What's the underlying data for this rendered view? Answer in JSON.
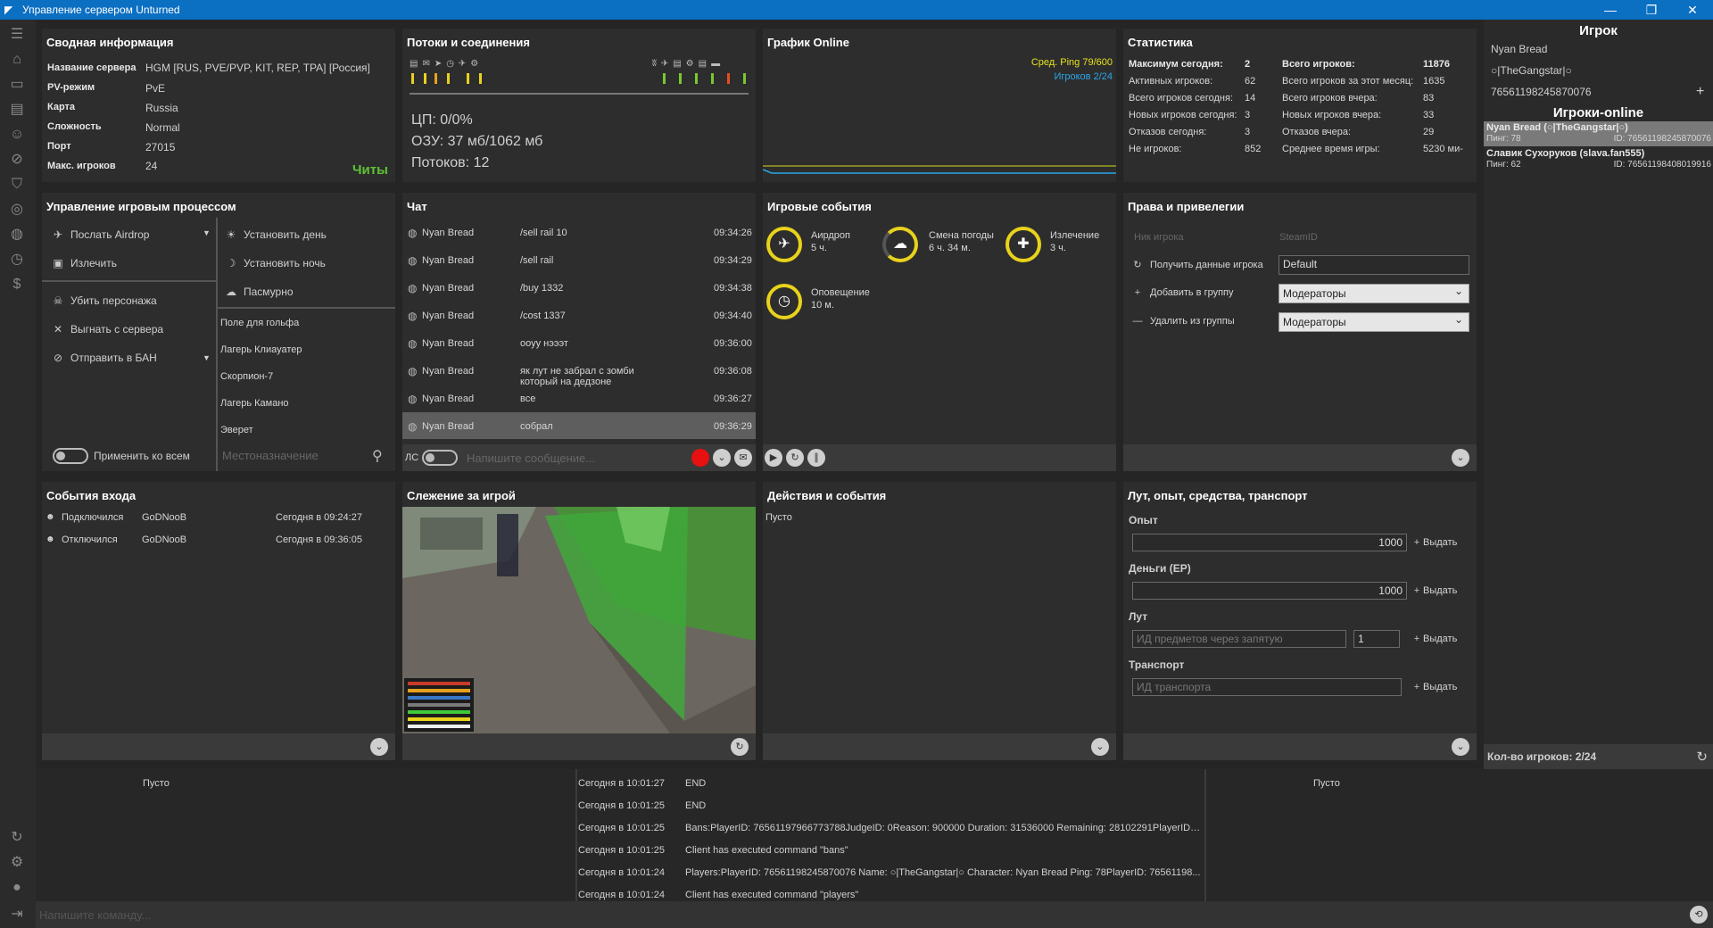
{
  "window": {
    "title": "Управление сервером Unturned",
    "min": "—",
    "max": "❐",
    "close": "✕"
  },
  "summary": {
    "title": "Сводная информация",
    "rows": [
      {
        "k": "Название сервера",
        "v": "HGM [RUS, PVE/PVP, KIT, REP, TPA] [Россия]"
      },
      {
        "k": "PV-режим",
        "v": "PvE"
      },
      {
        "k": "Карта",
        "v": "Russia"
      },
      {
        "k": "Сложность",
        "v": "Normal"
      },
      {
        "k": "Порт",
        "v": "27015"
      },
      {
        "k": "Макс. игроков",
        "v": "24"
      }
    ],
    "cheats": "Читы"
  },
  "threads": {
    "title": "Потоки и соединения",
    "cpu": "ЦП: 0/0%",
    "ram": "ОЗУ: 37 мб/1062 мб",
    "threads": "Потоков: 12"
  },
  "graph": {
    "title": "График Online",
    "ping": "Сред. Ping 79/600",
    "players": "Игроков 2/24"
  },
  "stats": {
    "title": "Статистика",
    "left": [
      {
        "k": "Максимум сегодня:",
        "v": "2"
      },
      {
        "k": "Активных игроков:",
        "v": "62"
      },
      {
        "k": "Всего игроков сегодня:",
        "v": "14"
      },
      {
        "k": "Новых игроков сегодня:",
        "v": "3"
      },
      {
        "k": "Отказов сегодня:",
        "v": "3"
      },
      {
        "k": "Не игроков:",
        "v": "852"
      }
    ],
    "right": [
      {
        "k": "Всего игроков:",
        "v": "11876"
      },
      {
        "k": "Всего игроков за этот месяц:",
        "v": "1635"
      },
      {
        "k": "Всего игроков вчера:",
        "v": "83"
      },
      {
        "k": "Новых игроков вчера:",
        "v": "33"
      },
      {
        "k": "Отказов вчера:",
        "v": "29"
      },
      {
        "k": "Среднее время игры:",
        "v": "5230 ми-"
      }
    ]
  },
  "player": {
    "title": "Игрок",
    "name": "Nyan Bread",
    "tag": "○|TheGangstar|○",
    "id": "76561198245870076",
    "online_title": "Игроки-online",
    "online": [
      {
        "name": "Nyan Bread (○|TheGangstar|○)",
        "ping": "Пинг: 78",
        "id": "ID: 76561198245870076"
      },
      {
        "name": "Славик Сухоруков (slava.fan555)",
        "ping": "Пинг: 62",
        "id": "ID: 76561198408019916"
      }
    ],
    "count": "Кол-во игроков: 2/24"
  },
  "game": {
    "title": "Управление игровым процессом",
    "left": [
      "Послать Airdrop",
      "Излечить",
      "Убить персонажа",
      "Выгнать с сервера",
      "Отправить в БАН"
    ],
    "right": [
      "Установить день",
      "Установить ночь",
      "Пасмурно"
    ],
    "locations": [
      "Поле для гольфа",
      "Лагерь Клиауатер",
      "Скорпион-7",
      "Лагерь Камано",
      "Эверет"
    ],
    "apply_all": "Применить ко всем",
    "dest_placeholder": "Местоназначение"
  },
  "chat": {
    "title": "Чат",
    "messages": [
      {
        "u": "Nyan Bread",
        "m": "/sell rail 10",
        "t": "09:34:26"
      },
      {
        "u": "Nyan Bread",
        "m": "/sell rail",
        "t": "09:34:29"
      },
      {
        "u": "Nyan Bread",
        "m": "/buy 1332",
        "t": "09:34:38"
      },
      {
        "u": "Nyan Bread",
        "m": "/cost 1337",
        "t": "09:34:40"
      },
      {
        "u": "Nyan Bread",
        "m": "ооуу нэээт",
        "t": "09:36:00"
      },
      {
        "u": "Nyan Bread",
        "m": "як лут не забрал с зомби который на дедзоне",
        "t": "09:36:08"
      },
      {
        "u": "Nyan Bread",
        "m": "все",
        "t": "09:36:27"
      },
      {
        "u": "Nyan Bread",
        "m": "собрал",
        "t": "09:36:29"
      }
    ],
    "ls": "ЛС",
    "placeholder": "Напишите сообщение..."
  },
  "events": {
    "title": "Игровые события",
    "items": [
      {
        "n": "Аирдроп",
        "t": "5 ч."
      },
      {
        "n": "Смена погоды",
        "t": "6 ч. 34 м."
      },
      {
        "n": "Излечение",
        "t": "3 ч."
      },
      {
        "n": "Оповещение",
        "t": "10 м."
      }
    ]
  },
  "rights": {
    "title": "Права и привелегии",
    "nick_ph": "Ник игрока",
    "steam_ph": "SteamID",
    "get": "Получить данные игрока",
    "group_value": "Default",
    "add": "Добавить в группу",
    "remove": "Удалить из группы",
    "group1": "Модераторы",
    "group2": "Модераторы"
  },
  "login": {
    "title": "События входа",
    "rows": [
      {
        "a": "Подключился",
        "u": "GoDNooB",
        "t": "Сегодня в 09:24:27"
      },
      {
        "a": "Отключился",
        "u": "GoDNooB",
        "t": "Сегодня в 09:36:05"
      }
    ]
  },
  "spectate": {
    "title": "Слежение за игрой"
  },
  "actions": {
    "title": "Действия и события",
    "empty": "Пусто"
  },
  "loot": {
    "title": "Лут, опыт, средства, транспорт",
    "exp": "Опыт",
    "exp_v": "1000",
    "money": "Деньги (ЕР)",
    "money_v": "1000",
    "loot": "Лут",
    "loot_ph": "ИД предметов через запятую",
    "qty": "1",
    "transport": "Транспорт",
    "transport_ph": "ИД транспорта",
    "give": "Выдать"
  },
  "console": {
    "left": "Пусто",
    "right": "Пусто",
    "placeholder": "Напишите команду...",
    "lines": [
      {
        "t": "Сегодня в 10:01:27",
        "m": "END"
      },
      {
        "t": "Сегодня в 10:01:25",
        "m": "END"
      },
      {
        "t": "Сегодня в 10:01:25",
        "m": "Bans:PlayerID: 76561197966773788JudgeID: 0Reason: 900000 Duration: 31536000 Remaining: 28102291PlayerID: ..."
      },
      {
        "t": "Сегодня в 10:01:25",
        "m": "Client has executed command \"bans\""
      },
      {
        "t": "Сегодня в 10:01:24",
        "m": "Players:PlayerID: 76561198245870076 Name: ○|TheGangstar|○ Character: Nyan Bread Ping: 78PlayerID: 76561198..."
      },
      {
        "t": "Сегодня в 10:01:24",
        "m": "Client has executed command \"players\""
      }
    ]
  }
}
